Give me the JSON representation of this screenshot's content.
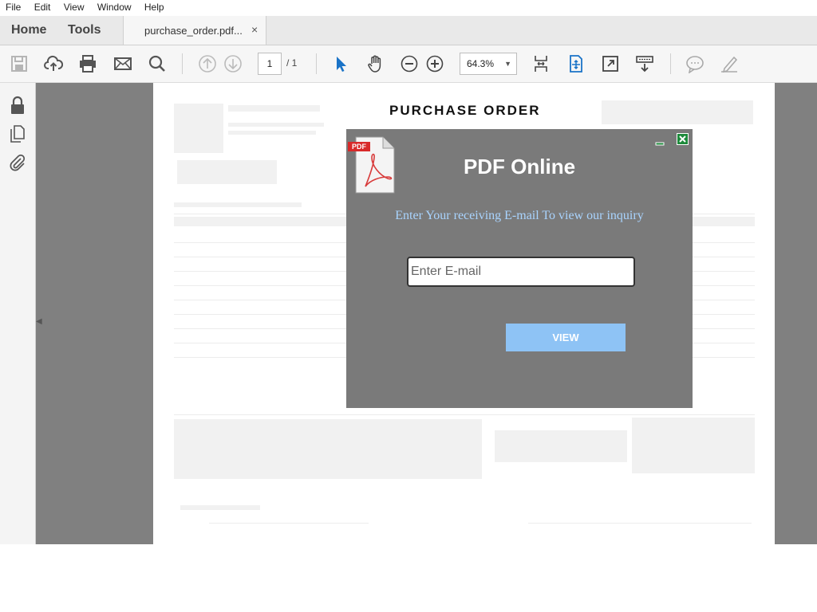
{
  "menu": [
    "File",
    "Edit",
    "View",
    "Window",
    "Help"
  ],
  "nav": {
    "home": "Home",
    "tools": "Tools"
  },
  "tab": {
    "name": "purchase_order.pdf...",
    "close": "×"
  },
  "toolbar": {
    "current_page": "1",
    "total_pages": "/ 1",
    "zoom": "64.3%",
    "icons": [
      "save-icon",
      "cloud-upload-icon",
      "print-icon",
      "email-icon",
      "search-icon",
      "page-up-icon",
      "page-down-icon",
      "select-arrow-icon",
      "hand-icon",
      "zoom-out-icon",
      "zoom-in-icon",
      "scroll-mode-icon",
      "fit-page-icon",
      "fullscreen-icon",
      "read-mode-icon",
      "comment-icon",
      "sign-icon"
    ]
  },
  "left_panel": {
    "icons": [
      "lock-icon",
      "pages-icon",
      "attachment-icon"
    ]
  },
  "document": {
    "title": "PURCHASE ORDER"
  },
  "popup": {
    "badge": "PDF",
    "heading": "PDF Online",
    "subtitle": "Enter Your receiving E-mail To view our inquiry",
    "email_placeholder": "Enter E-mail",
    "button": "VIEW",
    "colors": {
      "background": "#7a7a7a",
      "button": "#8ec3f5",
      "subtitle": "#a9d4ff"
    }
  }
}
